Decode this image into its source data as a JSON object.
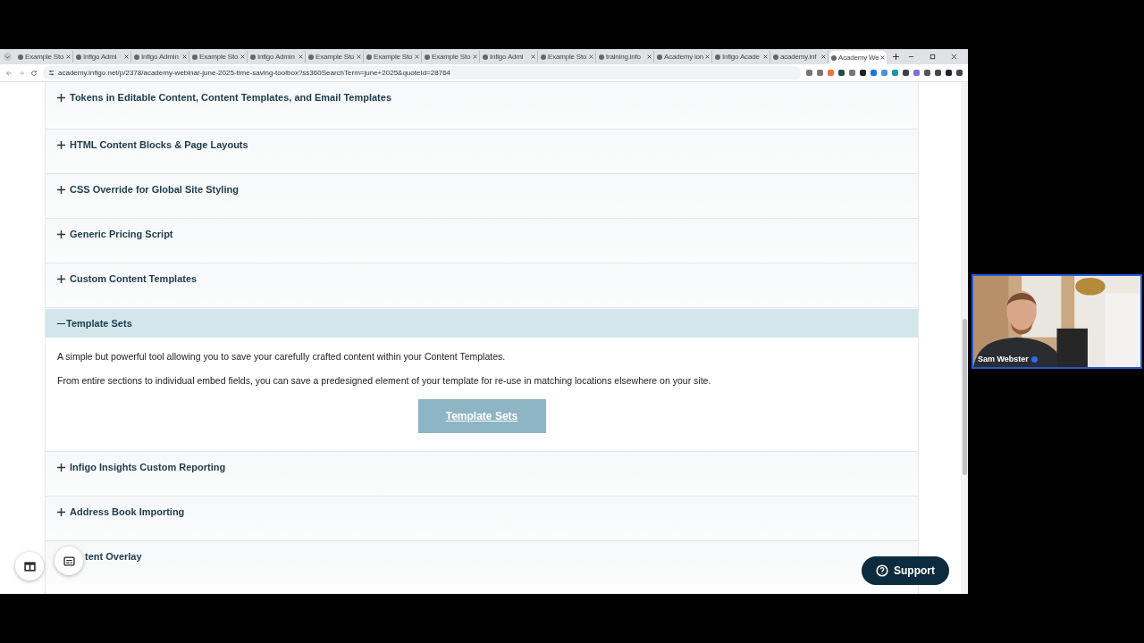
{
  "browser": {
    "tabs": [
      {
        "title": "Example Sto",
        "selected": false
      },
      {
        "title": "Infigo Admi",
        "selected": false
      },
      {
        "title": "Infigo Admin",
        "selected": false
      },
      {
        "title": "Example Sto",
        "selected": false
      },
      {
        "title": "Infigo Admin",
        "selected": false
      },
      {
        "title": "Example Sto",
        "selected": false
      },
      {
        "title": "Example Sto",
        "selected": false
      },
      {
        "title": "Example Sto",
        "selected": false
      },
      {
        "title": "Infigo Admi",
        "selected": false
      },
      {
        "title": "Example Sto",
        "selected": false
      },
      {
        "title": "training.info",
        "selected": false
      },
      {
        "title": "Academy ion",
        "selected": false
      },
      {
        "title": "Infigo Acade",
        "selected": false
      },
      {
        "title": "academy.inf",
        "selected": false
      },
      {
        "title": "Academy We",
        "selected": true
      }
    ],
    "address": "academy.infigo.net/p/2378/academy-webinar-june-2025-time-saving-toolbox?ss360SearchTerm=june+2025&quoteId=28764"
  },
  "accordion": [
    {
      "title": "Tokens in Editable Content, Content Templates, and Email Templates",
      "expanded": false
    },
    {
      "title": "HTML Content Blocks & Page Layouts",
      "expanded": false
    },
    {
      "title": "CSS Override for Global Site Styling",
      "expanded": false
    },
    {
      "title": "Generic Pricing Script",
      "expanded": false
    },
    {
      "title": "Custom Content Templates",
      "expanded": false
    },
    {
      "title": "Template Sets",
      "expanded": true,
      "paragraphs": [
        "A simple but powerful tool allowing you to save your carefully crafted content within your Content Templates.",
        "From entire sections to individual embed fields, you can save a predesigned element of your template for re-use in matching locations elsewhere on your site."
      ],
      "button": "Template Sets"
    },
    {
      "title": "Infigo Insights Custom Reporting",
      "expanded": false
    },
    {
      "title": "Address Book Importing",
      "expanded": false
    },
    {
      "title": "tent Overlay",
      "expanded": false
    }
  ],
  "support_button": "Support",
  "video_tile": {
    "kind": "picture",
    "name": "Sam Webster"
  }
}
